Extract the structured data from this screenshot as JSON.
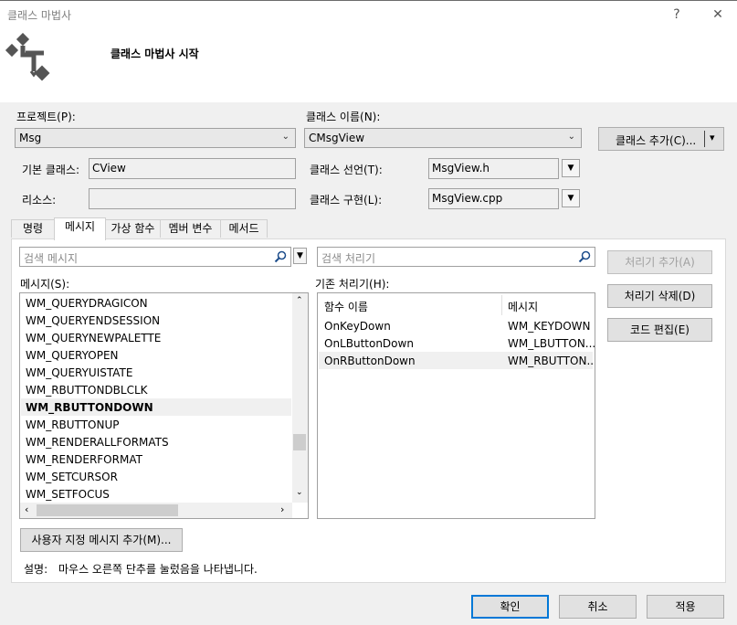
{
  "window": {
    "title": "클래스 마법사",
    "help_label": "?",
    "close_label": "✕"
  },
  "header": {
    "title": "클래스 마법사 시작"
  },
  "project": {
    "label": "프로젝트(P):",
    "value": "Msg"
  },
  "class_name": {
    "label": "클래스 이름(N):",
    "value": "CMsgView"
  },
  "add_class_button": {
    "label": "클래스 추가(C)...",
    "arrow": "▾"
  },
  "base_class": {
    "label": "기본 클래스:",
    "value": "CView"
  },
  "class_decl": {
    "label": "클래스 선언(T):",
    "value": "MsgView.h"
  },
  "resource": {
    "label": "리소스:",
    "value": ""
  },
  "class_impl": {
    "label": "클래스 구현(L):",
    "value": "MsgView.cpp"
  },
  "tabs": [
    {
      "label": "명령"
    },
    {
      "label": "메시지"
    },
    {
      "label": "가상 함수"
    },
    {
      "label": "멤버 변수"
    },
    {
      "label": "메서드"
    }
  ],
  "message_search": {
    "placeholder": "검색 메시지"
  },
  "handler_search": {
    "placeholder": "검색 처리기"
  },
  "messages_label": "메시지(S):",
  "messages": [
    "WM_QUERYDRAGICON",
    "WM_QUERYENDSESSION",
    "WM_QUERYNEWPALETTE",
    "WM_QUERYOPEN",
    "WM_QUERYUISTATE",
    "WM_RBUTTONDBLCLK",
    "WM_RBUTTONDOWN",
    "WM_RBUTTONUP",
    "WM_RENDERALLFORMATS",
    "WM_RENDERFORMAT",
    "WM_SETCURSOR",
    "WM_SETFOCUS"
  ],
  "selected_message": "WM_RBUTTONDOWN",
  "handlers_label": "기존 처리기(H):",
  "handler_columns": [
    "함수 이름",
    "메시지"
  ],
  "handlers": [
    {
      "func": "OnKeyDown",
      "msg": "WM_KEYDOWN"
    },
    {
      "func": "OnLButtonDown",
      "msg": "WM_LBUTTON..."
    },
    {
      "func": "OnRButtonDown",
      "msg": "WM_RBUTTON..."
    }
  ],
  "side_buttons": {
    "add_handler": "처리기 추가(A)",
    "delete_handler": "처리기 삭제(D)",
    "edit_code": "코드 편집(E)"
  },
  "add_custom_message": "사용자 지정 메시지 추가(M)...",
  "description": {
    "label": "설명:",
    "text": "마우스 오른쪽 단추를 눌렀음을 나타냅니다."
  },
  "footer": {
    "ok": "확인",
    "cancel": "취소",
    "apply": "적용"
  },
  "colors": {
    "window_bg": "#f0f0f0",
    "accent_border": "#0078d7",
    "disabled_text": "#a0a0a0"
  },
  "icons": {
    "wizard": "class-wizard-diagram-icon",
    "search": "magnifier-icon",
    "dropdown": "chevron-down-icon"
  }
}
